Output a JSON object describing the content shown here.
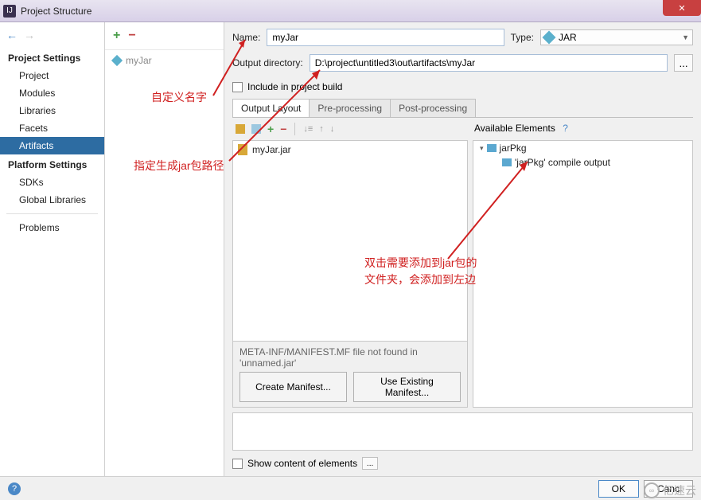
{
  "titlebar": {
    "title": "Project Structure"
  },
  "sidebar": {
    "heading1": "Project Settings",
    "items1": [
      "Project",
      "Modules",
      "Libraries",
      "Facets",
      "Artifacts"
    ],
    "heading2": "Platform Settings",
    "items2": [
      "SDKs",
      "Global Libraries"
    ],
    "problems": "Problems"
  },
  "artifacts": {
    "selected": "myJar"
  },
  "main": {
    "name_label": "Name:",
    "name_value": "myJar",
    "type_label": "Type:",
    "type_value": "JAR",
    "outdir_label": "Output directory:",
    "outdir_value": "D:\\project\\untitled3\\out\\artifacts\\myJar",
    "include_label": "Include in project build",
    "tabs": [
      "Output Layout",
      "Pre-processing",
      "Post-processing"
    ],
    "jar_file": "myJar.jar",
    "avail_label": "Available Elements",
    "avail_help": "?",
    "tree_root": "jarPkg",
    "tree_child": "'jarPkg' compile output",
    "manifest_msg": "META-INF/MANIFEST.MF file not found in 'unnamed.jar'",
    "create_manifest": "Create Manifest...",
    "use_manifest": "Use Existing Manifest...",
    "show_content": "Show content of elements",
    "browse_ellipsis": "..."
  },
  "footer": {
    "ok": "OK",
    "cancel": "Canc"
  },
  "annotations": {
    "a1": "自定义名字",
    "a2": "指定生成jar包路径",
    "a3": "双击需要添加到jar包的\n文件夹，会添加到左边"
  },
  "watermark": "亿速云"
}
